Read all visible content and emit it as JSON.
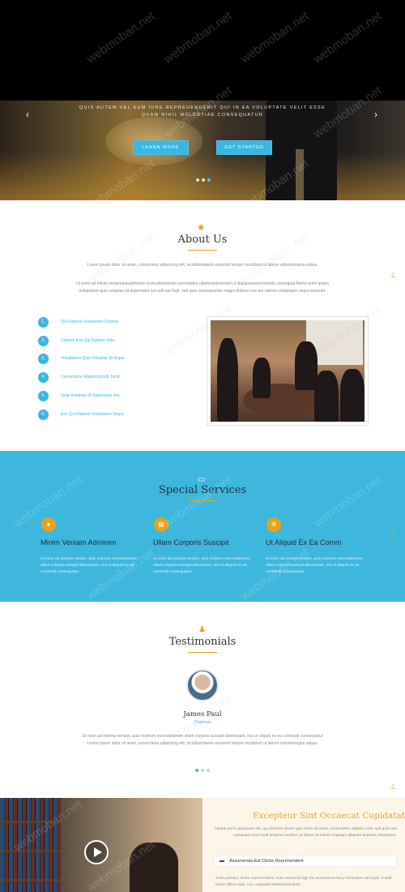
{
  "hero": {
    "caption": "QUIS AUTEM VEL EUM IURE REPREHENDERIT QUI IN EA VOLUPTATE VELIT ESSE QUAM NIHIL MOLESTIAE CONSEQUATUR",
    "learn_more": "LEARN MORE",
    "get_started": "GET STARTED",
    "arrow_left": "‹",
    "arrow_right": "›"
  },
  "about": {
    "title": "About Us",
    "icon": "lightbulb-icon",
    "text1": "Lorem ipsum dolor sit amet, consectetur adipiscing elit, incididuntiaedo eiusmod tempor incididunt ut labore etdolormagna aliqua.",
    "text2": "Ut enim ad minim veniamquisadmintm ncstrudtommodo exercitation ullamcolaboriosnil ut aliquipexeacommodo consequat Nemo enim ipsam voluptatem quia voluptas sit aspernatur aut odit aut fugit, sed quia consequuntur magni dolores eos qui ratione voluptatem sequi nesciunt.",
    "items": [
      {
        "num": "1.",
        "label": "Qui Ratione Voluptatem Dolores"
      },
      {
        "num": "2.",
        "label": "Dolores Eos Qui Ratione Volu"
      },
      {
        "num": "3.",
        "label": "Voluptatem Quia Voluptas Sit Asper"
      },
      {
        "num": "4.",
        "label": "Consectetur Adipiscing Elit, Incid"
      },
      {
        "num": "5.",
        "label": "Quia Voluptas Sit Aspernatur Aut"
      },
      {
        "num": "6.",
        "label": "Eos Qui Ratione Voluptatem Sequi"
      }
    ]
  },
  "services": {
    "title": "Special Services",
    "icon": "monitor-icon",
    "items": [
      {
        "icon": "user-icon",
        "glyph": "●",
        "title": "Minim Veniam Adminim",
        "text": "Ut enim ad minima veniam, quis nostrum exercitationem ullam corporis suscipit laboriosam, nisi ut aliquid ex ea commodi consequatur."
      },
      {
        "icon": "chart-icon",
        "glyph": "▤",
        "title": "Ullam Corporis Suscipit",
        "text": "Ut enim ad minima veniam, quis nostrum exercitationem ullam corporis suscipit laboriosam, nisi ut aliquid ex ea commodi consequatur."
      },
      {
        "icon": "gear-icon",
        "glyph": "✲",
        "title": "Ut Aliquid Ex Ea Comm",
        "text": "Ut enim ad minima veniam, quis nostrum exercitationem ullam corporis suscipit laboriosam, nisi ut aliquid ex ea commodi consequatur."
      }
    ]
  },
  "testimonials": {
    "title": "Testimonials",
    "icon": "users-icon",
    "name": "James Paul",
    "role": "Chairman",
    "text": "Ut enim ad minima veniam, quis nostrum exercitationem ullam corporis suscipit laboriosam, nisi ut aliquid ex ea commodi consequatur Lorem ipsum dolor sit amet, consectetur adipiscing elit, incididuntiaedo eiusmod tempor incididunt ut labore etdolormagna aliqua."
  },
  "bottom": {
    "title": "Excepteur Sint Occaecat Cupidatat",
    "text": "Neque porro quisquam est, qui dolorem ipsum quia dolor sit amet, consectetur, adipisci velit, sed quia non numquam eius modi tempora incidunt ut labore et dolore magnam aliquam quaerat voluptatem.",
    "accordion_label": "Assumenda Est Cliche Reprehenderit",
    "accordion_text": "Anim pariatur cliche reprehenderit, enim eiusmod high life accusamus terry richardson ad squid. 3 wolf moon officia aute, non cupidatat skateboard dolor"
  },
  "watermark": "webmoban.net",
  "colors": {
    "accent": "#e8a21a",
    "primary": "#3bb6e0"
  }
}
